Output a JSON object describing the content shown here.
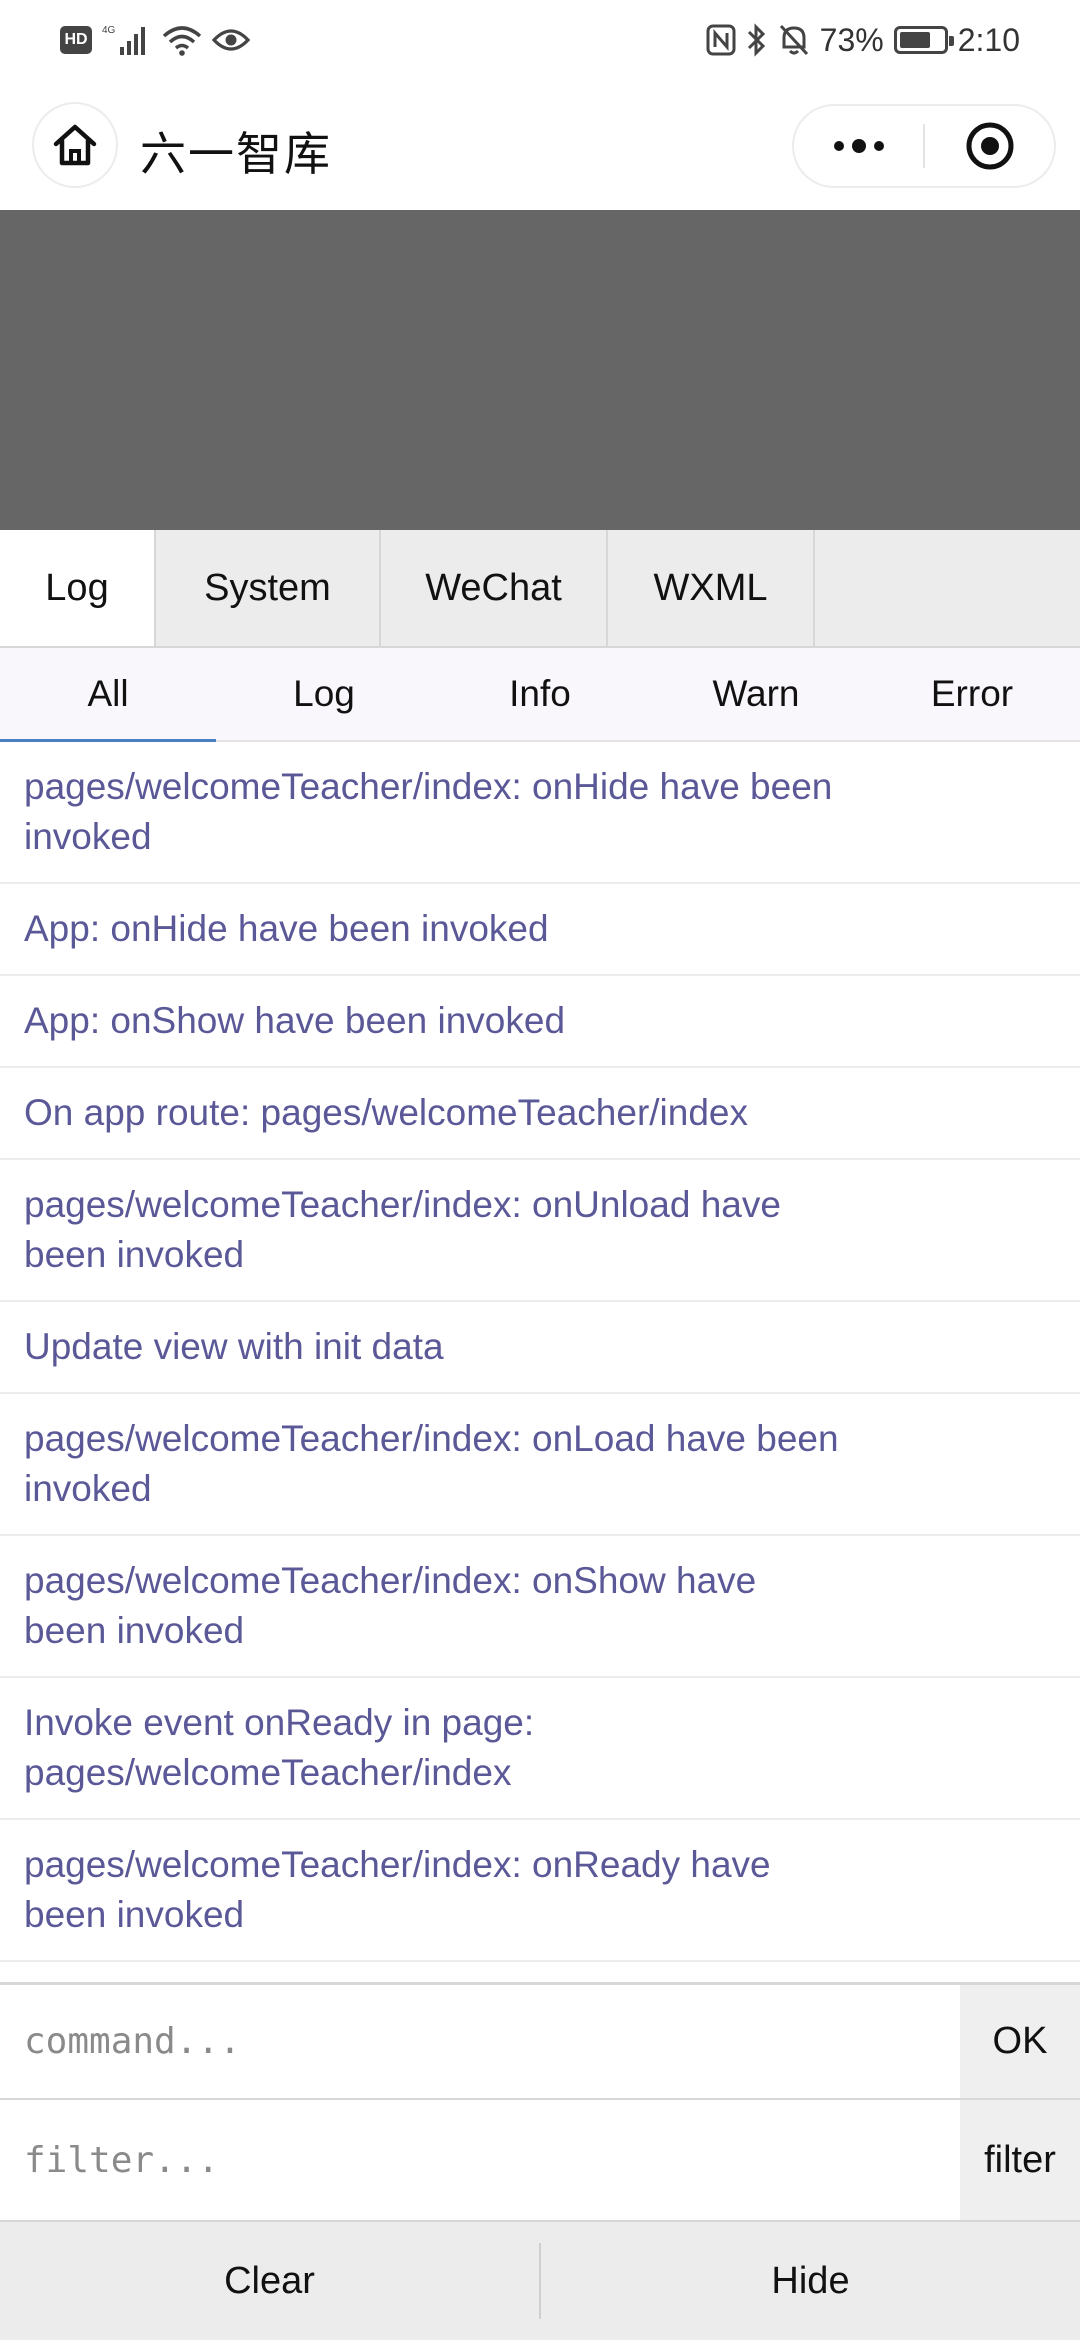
{
  "status_bar": {
    "hd_label": "HD",
    "network_label": "4G",
    "battery_percent": "73%",
    "battery_level": 0.73,
    "time": "2:10",
    "icons": [
      "hd-icon",
      "signal-icon",
      "wifi-icon",
      "eye-icon",
      "nfc-icon",
      "bluetooth-icon",
      "mute-bell-icon",
      "battery-icon"
    ]
  },
  "title_bar": {
    "title": "六一智库",
    "home_icon": "home-icon",
    "more_icon": "more-dots-icon",
    "close_icon": "target-circle-icon"
  },
  "panel_tabs": [
    {
      "label": "Log",
      "active": true
    },
    {
      "label": "System",
      "active": false
    },
    {
      "label": "WeChat",
      "active": false
    },
    {
      "label": "WXML",
      "active": false
    }
  ],
  "sub_tabs": [
    {
      "label": "All",
      "active": true
    },
    {
      "label": "Log",
      "active": false
    },
    {
      "label": "Info",
      "active": false
    },
    {
      "label": "Warn",
      "active": false
    },
    {
      "label": "Error",
      "active": false
    }
  ],
  "logs": [
    "pages/welcomeTeacher/index: onHide have been invoked",
    "App: onHide have been invoked",
    "App: onShow have been invoked",
    "On app route: pages/welcomeTeacher/index",
    "pages/welcomeTeacher/index: onUnload have been invoked",
    "Update view with init data",
    "pages/welcomeTeacher/index: onLoad have been invoked",
    "pages/welcomeTeacher/index: onShow have been invoked",
    "Invoke event onReady in page: pages/welcomeTeacher/index",
    "pages/welcomeTeacher/index: onReady have been invoked"
  ],
  "command": {
    "placeholder": "command...",
    "value": "",
    "button": "OK"
  },
  "filter": {
    "placeholder": "filter...",
    "value": "",
    "button": "filter"
  },
  "bottom": {
    "clear": "Clear",
    "hide": "Hide"
  },
  "colors": {
    "log_text": "#5b5898",
    "mask": "#666666",
    "active_underline": "#4a7fbf"
  }
}
